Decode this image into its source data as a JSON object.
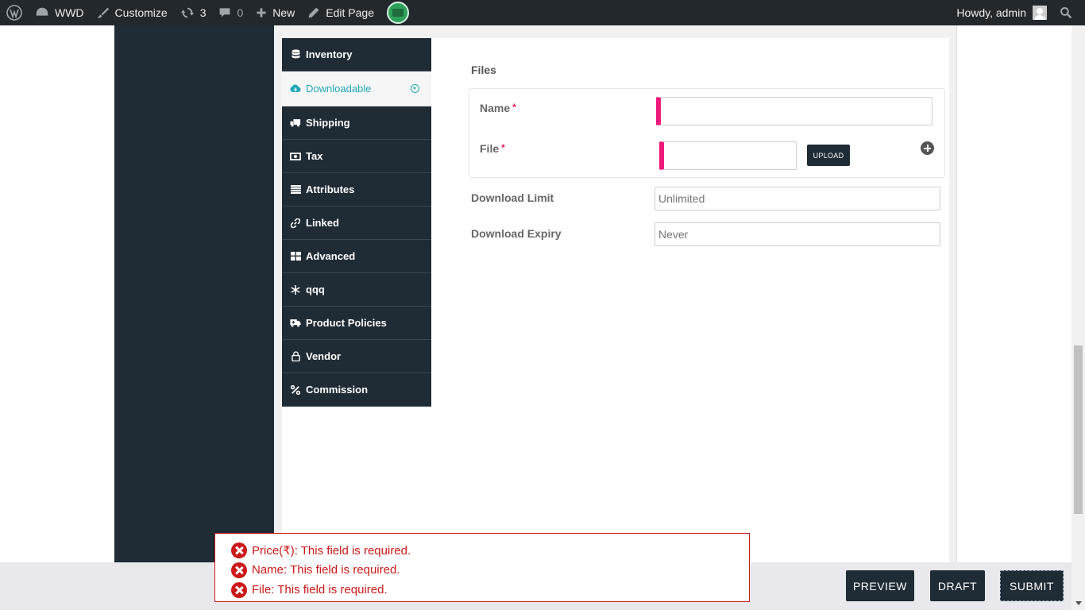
{
  "adminbar": {
    "site_name": "WWD",
    "customize": "Customize",
    "updates_count": "3",
    "comments_count": "0",
    "new_label": "New",
    "edit_page": "Edit Page",
    "howdy": "Howdy, admin"
  },
  "tabs": [
    {
      "label": "Inventory",
      "icon": "database-icon"
    },
    {
      "label": "Downloadable",
      "icon": "cloud-download-icon",
      "active": true
    },
    {
      "label": "Shipping",
      "icon": "truck-icon"
    },
    {
      "label": "Tax",
      "icon": "money-icon"
    },
    {
      "label": "Attributes",
      "icon": "list-icon"
    },
    {
      "label": "Linked",
      "icon": "link-icon"
    },
    {
      "label": "Advanced",
      "icon": "grid-icon"
    },
    {
      "label": "qqq",
      "icon": "snowflake-icon"
    },
    {
      "label": "Product Policies",
      "icon": "ambulance-icon"
    },
    {
      "label": "Vendor",
      "icon": "lock-icon"
    },
    {
      "label": "Commission",
      "icon": "percent-icon"
    }
  ],
  "form": {
    "files_label": "Files",
    "name_label": "Name",
    "file_label": "File",
    "required_mark": "*",
    "upload_label": "UPLOAD",
    "download_limit_label": "Download Limit",
    "download_limit_placeholder": "Unlimited",
    "download_expiry_label": "Download Expiry",
    "download_expiry_placeholder": "Never"
  },
  "footer": {
    "preview": "PREVIEW",
    "draft": "DRAFT",
    "submit": "SUBMIT"
  },
  "errors": [
    "Price(₹): This field is required.",
    "Name: This field is required.",
    "File: This field is required."
  ],
  "colors": {
    "dark": "#1f2b35",
    "accent": "#20a8b8",
    "error": "#cc1818",
    "required_marker": "#ee1a7b"
  }
}
